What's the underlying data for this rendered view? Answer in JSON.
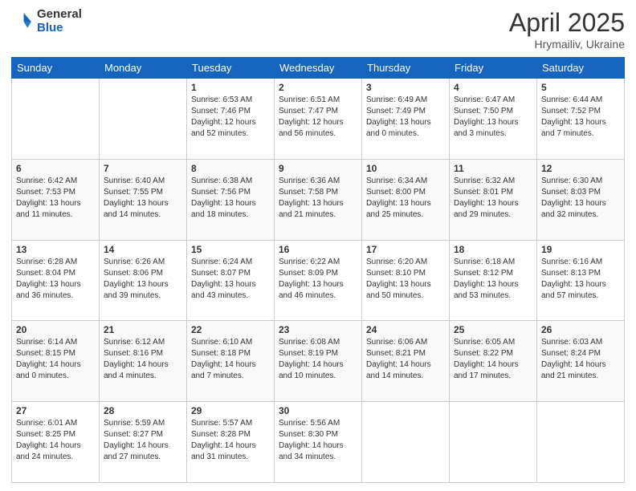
{
  "header": {
    "logo_general": "General",
    "logo_blue": "Blue",
    "title": "April 2025",
    "subtitle": "Hrymailiv, Ukraine"
  },
  "days_of_week": [
    "Sunday",
    "Monday",
    "Tuesday",
    "Wednesday",
    "Thursday",
    "Friday",
    "Saturday"
  ],
  "weeks": [
    [
      {
        "day": "",
        "info": ""
      },
      {
        "day": "",
        "info": ""
      },
      {
        "day": "1",
        "info": "Sunrise: 6:53 AM\nSunset: 7:46 PM\nDaylight: 12 hours and 52 minutes."
      },
      {
        "day": "2",
        "info": "Sunrise: 6:51 AM\nSunset: 7:47 PM\nDaylight: 12 hours and 56 minutes."
      },
      {
        "day": "3",
        "info": "Sunrise: 6:49 AM\nSunset: 7:49 PM\nDaylight: 13 hours and 0 minutes."
      },
      {
        "day": "4",
        "info": "Sunrise: 6:47 AM\nSunset: 7:50 PM\nDaylight: 13 hours and 3 minutes."
      },
      {
        "day": "5",
        "info": "Sunrise: 6:44 AM\nSunset: 7:52 PM\nDaylight: 13 hours and 7 minutes."
      }
    ],
    [
      {
        "day": "6",
        "info": "Sunrise: 6:42 AM\nSunset: 7:53 PM\nDaylight: 13 hours and 11 minutes."
      },
      {
        "day": "7",
        "info": "Sunrise: 6:40 AM\nSunset: 7:55 PM\nDaylight: 13 hours and 14 minutes."
      },
      {
        "day": "8",
        "info": "Sunrise: 6:38 AM\nSunset: 7:56 PM\nDaylight: 13 hours and 18 minutes."
      },
      {
        "day": "9",
        "info": "Sunrise: 6:36 AM\nSunset: 7:58 PM\nDaylight: 13 hours and 21 minutes."
      },
      {
        "day": "10",
        "info": "Sunrise: 6:34 AM\nSunset: 8:00 PM\nDaylight: 13 hours and 25 minutes."
      },
      {
        "day": "11",
        "info": "Sunrise: 6:32 AM\nSunset: 8:01 PM\nDaylight: 13 hours and 29 minutes."
      },
      {
        "day": "12",
        "info": "Sunrise: 6:30 AM\nSunset: 8:03 PM\nDaylight: 13 hours and 32 minutes."
      }
    ],
    [
      {
        "day": "13",
        "info": "Sunrise: 6:28 AM\nSunset: 8:04 PM\nDaylight: 13 hours and 36 minutes."
      },
      {
        "day": "14",
        "info": "Sunrise: 6:26 AM\nSunset: 8:06 PM\nDaylight: 13 hours and 39 minutes."
      },
      {
        "day": "15",
        "info": "Sunrise: 6:24 AM\nSunset: 8:07 PM\nDaylight: 13 hours and 43 minutes."
      },
      {
        "day": "16",
        "info": "Sunrise: 6:22 AM\nSunset: 8:09 PM\nDaylight: 13 hours and 46 minutes."
      },
      {
        "day": "17",
        "info": "Sunrise: 6:20 AM\nSunset: 8:10 PM\nDaylight: 13 hours and 50 minutes."
      },
      {
        "day": "18",
        "info": "Sunrise: 6:18 AM\nSunset: 8:12 PM\nDaylight: 13 hours and 53 minutes."
      },
      {
        "day": "19",
        "info": "Sunrise: 6:16 AM\nSunset: 8:13 PM\nDaylight: 13 hours and 57 minutes."
      }
    ],
    [
      {
        "day": "20",
        "info": "Sunrise: 6:14 AM\nSunset: 8:15 PM\nDaylight: 14 hours and 0 minutes."
      },
      {
        "day": "21",
        "info": "Sunrise: 6:12 AM\nSunset: 8:16 PM\nDaylight: 14 hours and 4 minutes."
      },
      {
        "day": "22",
        "info": "Sunrise: 6:10 AM\nSunset: 8:18 PM\nDaylight: 14 hours and 7 minutes."
      },
      {
        "day": "23",
        "info": "Sunrise: 6:08 AM\nSunset: 8:19 PM\nDaylight: 14 hours and 10 minutes."
      },
      {
        "day": "24",
        "info": "Sunrise: 6:06 AM\nSunset: 8:21 PM\nDaylight: 14 hours and 14 minutes."
      },
      {
        "day": "25",
        "info": "Sunrise: 6:05 AM\nSunset: 8:22 PM\nDaylight: 14 hours and 17 minutes."
      },
      {
        "day": "26",
        "info": "Sunrise: 6:03 AM\nSunset: 8:24 PM\nDaylight: 14 hours and 21 minutes."
      }
    ],
    [
      {
        "day": "27",
        "info": "Sunrise: 6:01 AM\nSunset: 8:25 PM\nDaylight: 14 hours and 24 minutes."
      },
      {
        "day": "28",
        "info": "Sunrise: 5:59 AM\nSunset: 8:27 PM\nDaylight: 14 hours and 27 minutes."
      },
      {
        "day": "29",
        "info": "Sunrise: 5:57 AM\nSunset: 8:28 PM\nDaylight: 14 hours and 31 minutes."
      },
      {
        "day": "30",
        "info": "Sunrise: 5:56 AM\nSunset: 8:30 PM\nDaylight: 14 hours and 34 minutes."
      },
      {
        "day": "",
        "info": ""
      },
      {
        "day": "",
        "info": ""
      },
      {
        "day": "",
        "info": ""
      }
    ]
  ]
}
